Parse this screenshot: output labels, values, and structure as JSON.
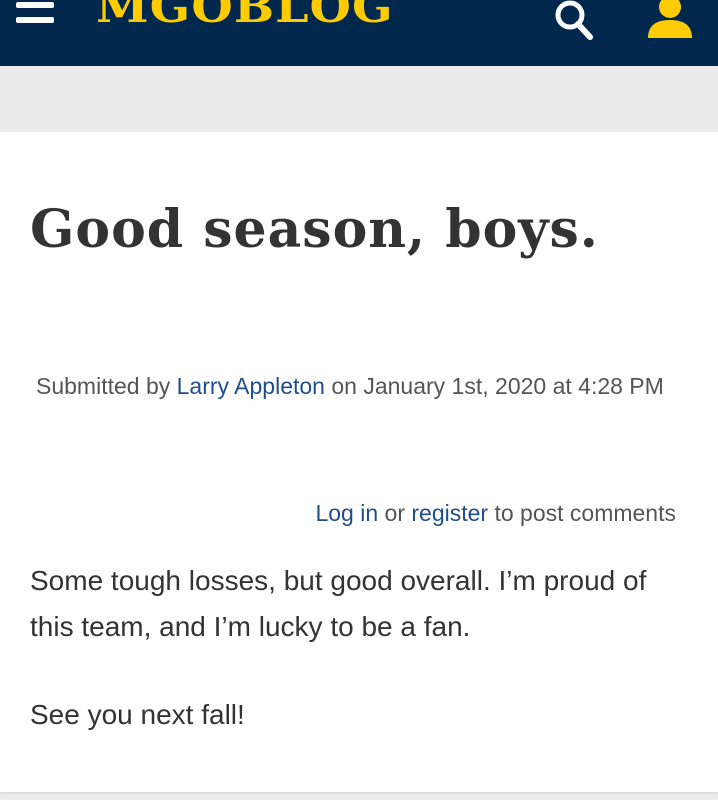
{
  "header": {
    "logo_text": "MGOBLOG",
    "menu_icon": "hamburger-menu-icon",
    "search_icon": "search-icon",
    "user_icon": "user-icon",
    "colors": {
      "background": "#00274c",
      "logo": "#ffcb05",
      "icon_accent": "#ffcb05"
    }
  },
  "post": {
    "title": "Good season, boys.",
    "meta": {
      "submitted_by_label": "Submitted by",
      "author": "Larry Appleton",
      "on_label": "on",
      "date": "January 1st, 2020 at 4:28 PM"
    },
    "comments_prompt": {
      "login_label": "Log in",
      "or_label": "or",
      "register_label": "register",
      "suffix": "to post comments"
    },
    "body": [
      "Some tough losses, but good overall. I’m proud of this team, and I’m lucky to be a fan.",
      "See you next fall!"
    ],
    "colors": {
      "link": "#1f4e8c",
      "text": "#333333",
      "meta_text": "#555555"
    }
  }
}
